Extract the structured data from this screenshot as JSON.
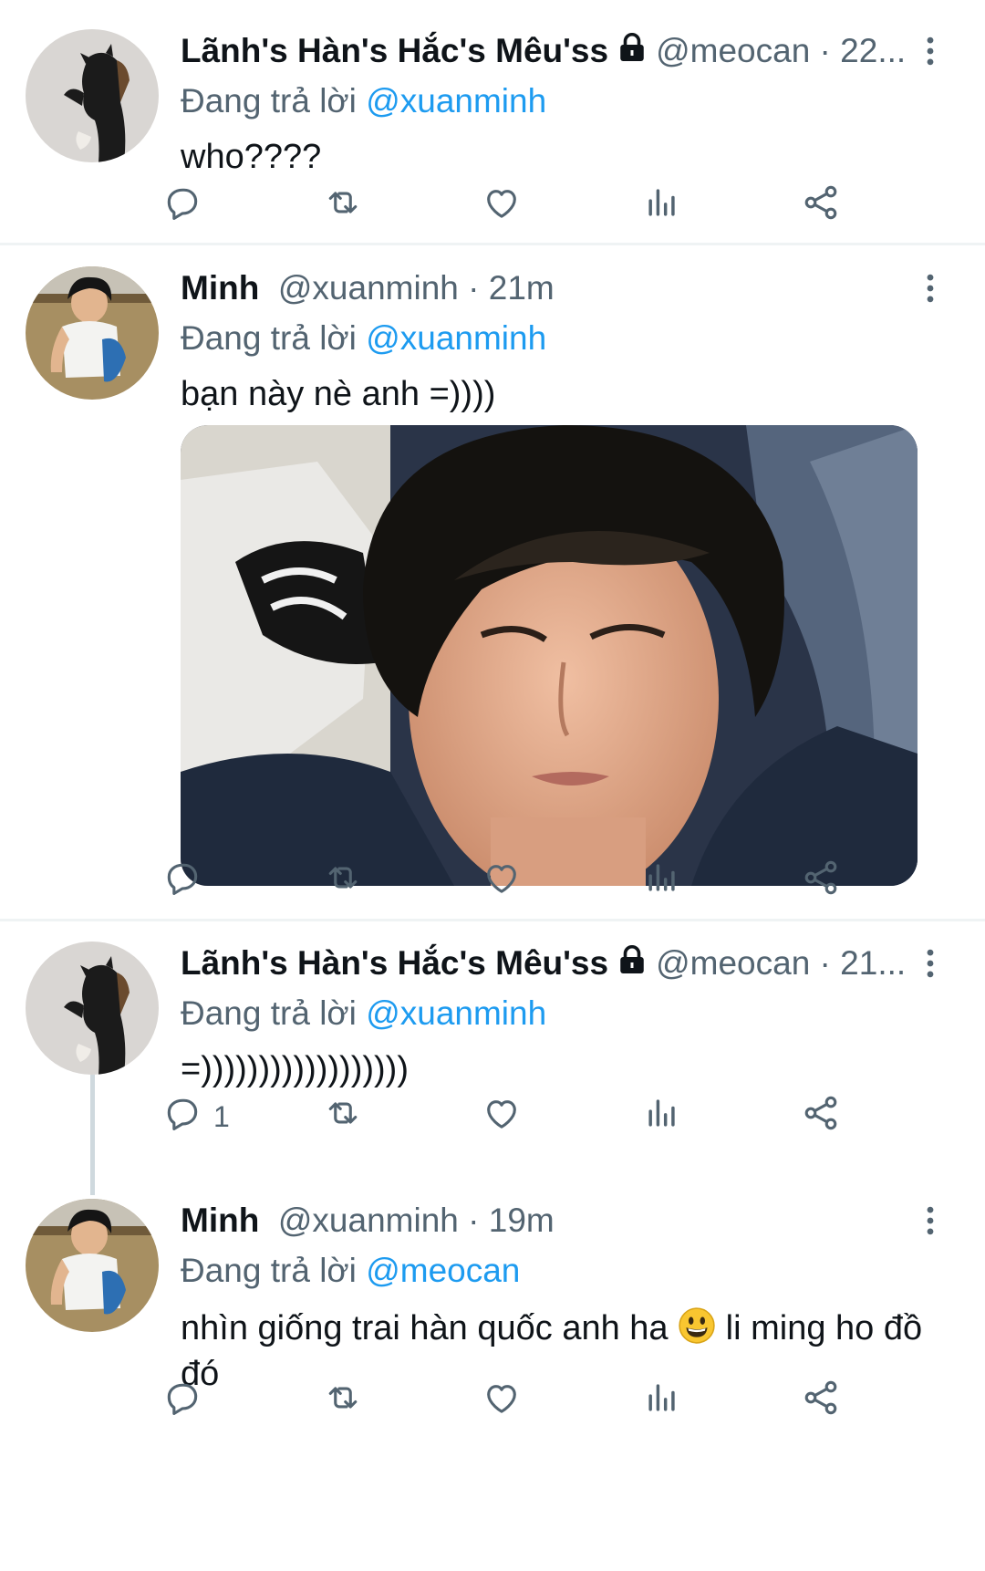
{
  "tweets": [
    {
      "name": "Lãnh's Hàn's Hắc's Mêu'ss",
      "handle": "@meocan",
      "sep": " · ",
      "time": "22...",
      "reply_prefix": "Đang trả lời ",
      "reply_to": "@xuanminh",
      "text": "who????",
      "reply_count": ""
    },
    {
      "name": "Minh",
      "handle": "@xuanminh",
      "sep": " · ",
      "time": "21m",
      "reply_prefix": "Đang trả lời ",
      "reply_to": "@xuanminh",
      "text": "bạn này nè anh =))))",
      "has_media": true,
      "reply_count": ""
    },
    {
      "name": "Lãnh's Hàn's Hắc's Mêu'ss",
      "handle": "@meocan",
      "sep": " · ",
      "time": "21...",
      "reply_prefix": "Đang trả lời ",
      "reply_to": "@xuanminh",
      "text": "=))))))))))))))))))",
      "reply_count": "1"
    },
    {
      "name": "Minh",
      "handle": "@xuanminh",
      "sep": " · ",
      "time": "19m",
      "reply_prefix": "Đang trả lời ",
      "reply_to": "@meocan",
      "text_before_emoji": "nhìn giống trai hàn quốc anh ha ",
      "text_after_emoji": " li ming ho đồ đó",
      "reply_count": ""
    }
  ],
  "icons": {
    "reply": "reply-icon",
    "retweet": "retweet-icon",
    "like": "like-icon",
    "views": "views-icon",
    "share": "share-icon",
    "more": "more-icon",
    "lock": "lock-icon",
    "emoji": "grinning-face-emoji"
  },
  "colors": {
    "link": "#1d9bf0",
    "secondary": "#536471",
    "divider": "#eff3f4"
  }
}
